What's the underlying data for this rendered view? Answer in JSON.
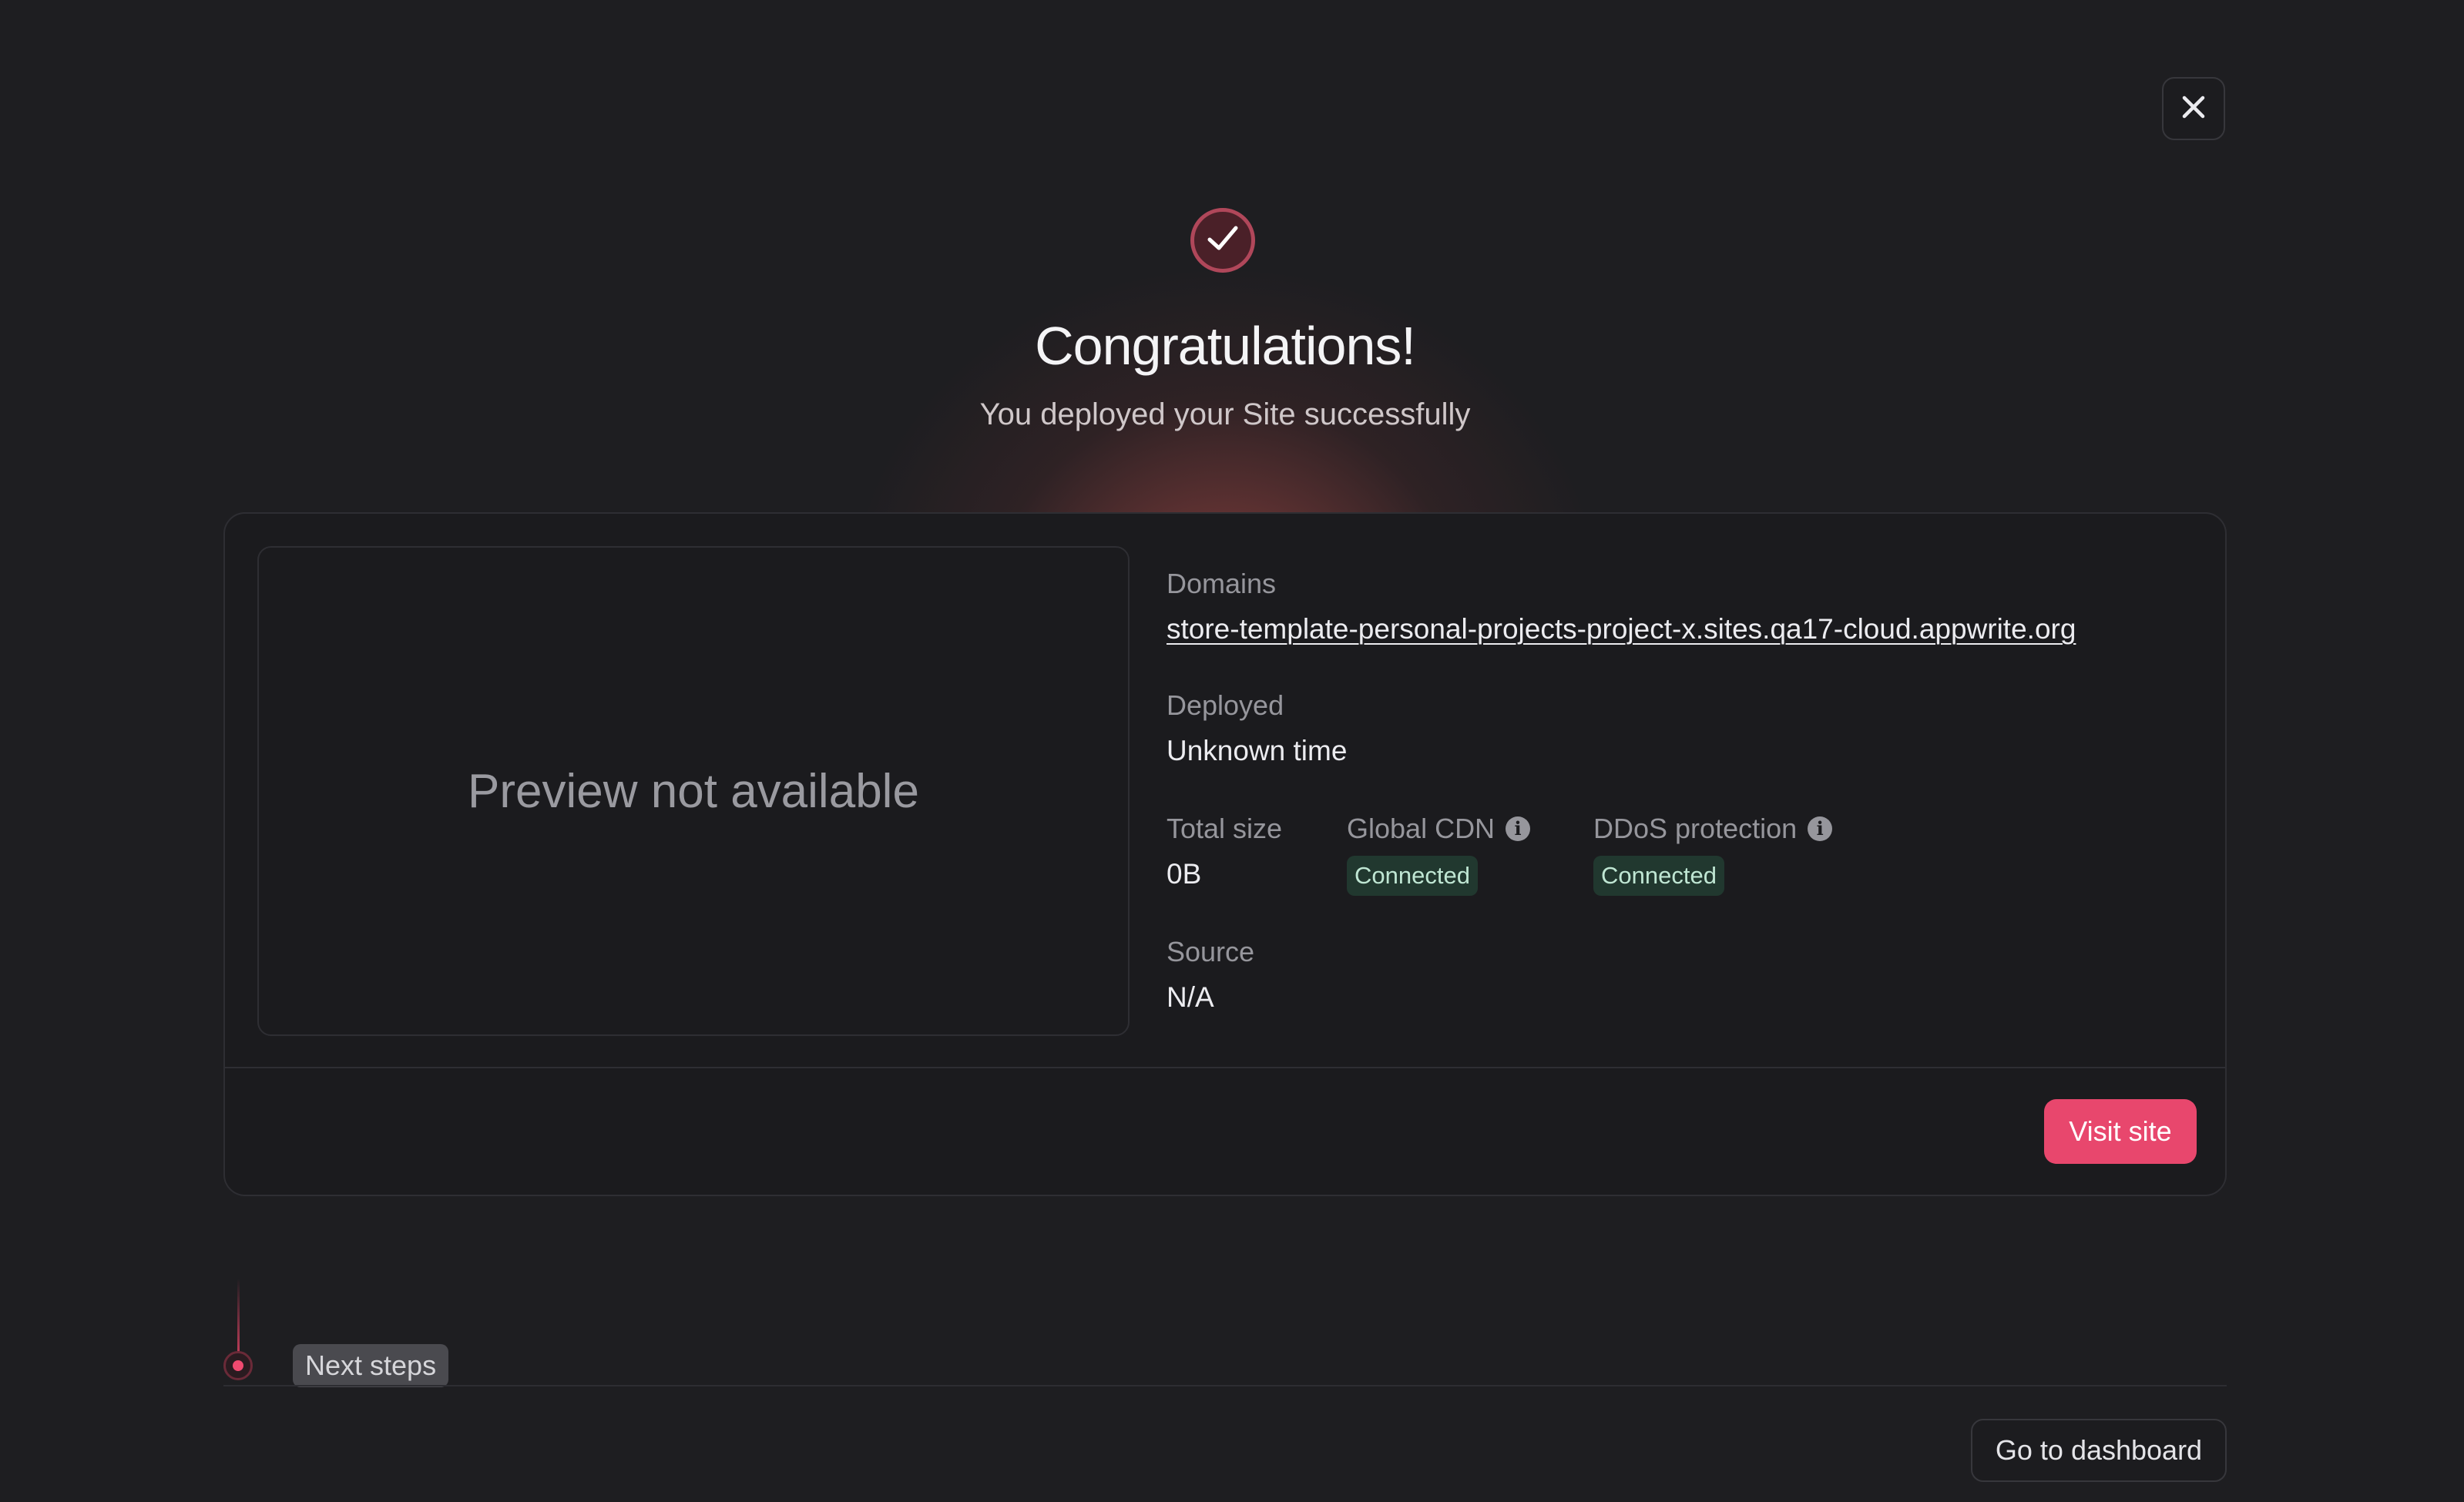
{
  "header": {
    "title": "Congratulations!",
    "subtitle": "You deployed your Site successfully",
    "close_icon": "close-icon",
    "status_icon": "check-icon"
  },
  "card": {
    "preview_text": "Preview not available",
    "domains": {
      "label": "Domains",
      "value": "store-template-personal-projects-project-x.sites.qa17-cloud.appwrite.org"
    },
    "deployed": {
      "label": "Deployed",
      "value": "Unknown time"
    },
    "total_size": {
      "label": "Total size",
      "value": "0B"
    },
    "global_cdn": {
      "label": "Global CDN",
      "status": "Connected",
      "info_icon": "info-icon"
    },
    "ddos_protection": {
      "label": "DDoS protection",
      "status": "Connected",
      "info_icon": "info-icon"
    },
    "source": {
      "label": "Source",
      "value": "N/A"
    },
    "visit_label": "Visit site"
  },
  "steps": {
    "next_steps_label": "Next steps"
  },
  "footer": {
    "dashboard_label": "Go to dashboard"
  },
  "colors": {
    "accent": "#e8476d",
    "background": "#1e1e21",
    "success_badge_bg": "#21382f",
    "success_badge_text": "#bfe6d3"
  }
}
